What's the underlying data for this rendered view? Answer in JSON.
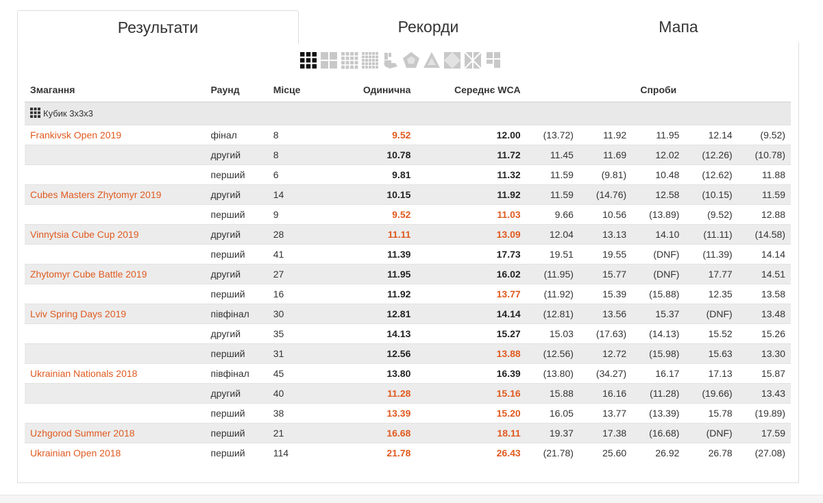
{
  "tabs": [
    {
      "label": "Результати",
      "active": true
    },
    {
      "label": "Рекорди",
      "active": false
    },
    {
      "label": "Мапа",
      "active": false
    }
  ],
  "events": [
    {
      "icon": "cube-3x3-icon",
      "selected": true
    },
    {
      "icon": "cube-2x2-icon",
      "selected": false
    },
    {
      "icon": "cube-4x4-icon",
      "selected": false
    },
    {
      "icon": "cube-5x5-icon",
      "selected": false
    },
    {
      "icon": "one-handed-icon",
      "selected": false
    },
    {
      "icon": "megaminx-icon",
      "selected": false
    },
    {
      "icon": "pyraminx-icon",
      "selected": false
    },
    {
      "icon": "skewb-icon",
      "selected": false
    },
    {
      "icon": "square-1-icon",
      "selected": false
    },
    {
      "icon": "clock-icon",
      "selected": false
    }
  ],
  "colors": {
    "accent": "#e05a1f",
    "stripe": "#ececec"
  },
  "table": {
    "headers": {
      "competition": "Змагання",
      "round": "Раунд",
      "place": "Місце",
      "single": "Одинична",
      "average": "Середнє WCA",
      "attempts": "Спроби"
    },
    "group_label": "Кубик 3x3x3",
    "rows": [
      {
        "competition": "Frankivsk Open 2019",
        "round": "фінал",
        "place": "8",
        "single": "9.52",
        "single_pr": true,
        "average": "12.00",
        "avg_pr": false,
        "attempts": [
          "(13.72)",
          "11.92",
          "11.95",
          "12.14",
          "(9.52)"
        ]
      },
      {
        "competition": "",
        "round": "другий",
        "place": "8",
        "single": "10.78",
        "single_pr": false,
        "average": "11.72",
        "avg_pr": false,
        "attempts": [
          "11.45",
          "11.69",
          "12.02",
          "(12.26)",
          "(10.78)"
        ]
      },
      {
        "competition": "",
        "round": "перший",
        "place": "6",
        "single": "9.81",
        "single_pr": false,
        "average": "11.32",
        "avg_pr": false,
        "attempts": [
          "11.59",
          "(9.81)",
          "10.48",
          "(12.62)",
          "11.88"
        ]
      },
      {
        "competition": "Cubes Masters Zhytomyr 2019",
        "round": "другий",
        "place": "14",
        "single": "10.15",
        "single_pr": false,
        "average": "11.92",
        "avg_pr": false,
        "attempts": [
          "11.59",
          "(14.76)",
          "12.58",
          "(10.15)",
          "11.59"
        ]
      },
      {
        "competition": "",
        "round": "перший",
        "place": "9",
        "single": "9.52",
        "single_pr": true,
        "average": "11.03",
        "avg_pr": true,
        "attempts": [
          "9.66",
          "10.56",
          "(13.89)",
          "(9.52)",
          "12.88"
        ]
      },
      {
        "competition": "Vinnytsia Cube Cup 2019",
        "round": "другий",
        "place": "28",
        "single": "11.11",
        "single_pr": true,
        "average": "13.09",
        "avg_pr": true,
        "attempts": [
          "12.04",
          "13.13",
          "14.10",
          "(11.11)",
          "(14.58)"
        ]
      },
      {
        "competition": "",
        "round": "перший",
        "place": "41",
        "single": "11.39",
        "single_pr": false,
        "average": "17.73",
        "avg_pr": false,
        "attempts": [
          "19.51",
          "19.55",
          "(DNF)",
          "(11.39)",
          "14.14"
        ]
      },
      {
        "competition": "Zhytomyr Cube Battle 2019",
        "round": "другий",
        "place": "27",
        "single": "11.95",
        "single_pr": false,
        "average": "16.02",
        "avg_pr": false,
        "attempts": [
          "(11.95)",
          "15.77",
          "(DNF)",
          "17.77",
          "14.51"
        ]
      },
      {
        "competition": "",
        "round": "перший",
        "place": "16",
        "single": "11.92",
        "single_pr": false,
        "average": "13.77",
        "avg_pr": true,
        "attempts": [
          "(11.92)",
          "15.39",
          "(15.88)",
          "12.35",
          "13.58"
        ]
      },
      {
        "competition": "Lviv Spring Days 2019",
        "round": "півфінал",
        "place": "30",
        "single": "12.81",
        "single_pr": false,
        "average": "14.14",
        "avg_pr": false,
        "attempts": [
          "(12.81)",
          "13.56",
          "15.37",
          "(DNF)",
          "13.48"
        ]
      },
      {
        "competition": "",
        "round": "другий",
        "place": "35",
        "single": "14.13",
        "single_pr": false,
        "average": "15.27",
        "avg_pr": false,
        "attempts": [
          "15.03",
          "(17.63)",
          "(14.13)",
          "15.52",
          "15.26"
        ]
      },
      {
        "competition": "",
        "round": "перший",
        "place": "31",
        "single": "12.56",
        "single_pr": false,
        "average": "13.88",
        "avg_pr": true,
        "attempts": [
          "(12.56)",
          "12.72",
          "(15.98)",
          "15.63",
          "13.30"
        ]
      },
      {
        "competition": "Ukrainian Nationals 2018",
        "round": "півфінал",
        "place": "45",
        "single": "13.80",
        "single_pr": false,
        "average": "16.39",
        "avg_pr": false,
        "attempts": [
          "(13.80)",
          "(34.27)",
          "16.17",
          "17.13",
          "15.87"
        ]
      },
      {
        "competition": "",
        "round": "другий",
        "place": "40",
        "single": "11.28",
        "single_pr": true,
        "average": "15.16",
        "avg_pr": true,
        "attempts": [
          "15.88",
          "16.16",
          "(11.28)",
          "(19.66)",
          "13.43"
        ]
      },
      {
        "competition": "",
        "round": "перший",
        "place": "38",
        "single": "13.39",
        "single_pr": true,
        "average": "15.20",
        "avg_pr": true,
        "attempts": [
          "16.05",
          "13.77",
          "(13.39)",
          "15.78",
          "(19.89)"
        ]
      },
      {
        "competition": "Uzhgorod Summer 2018",
        "round": "перший",
        "place": "21",
        "single": "16.68",
        "single_pr": true,
        "average": "18.11",
        "avg_pr": true,
        "attempts": [
          "19.37",
          "17.38",
          "(16.68)",
          "(DNF)",
          "17.59"
        ]
      },
      {
        "competition": "Ukrainian Open 2018",
        "round": "перший",
        "place": "114",
        "single": "21.78",
        "single_pr": true,
        "average": "26.43",
        "avg_pr": true,
        "attempts": [
          "(21.78)",
          "25.60",
          "26.92",
          "26.78",
          "(27.08)"
        ]
      }
    ]
  }
}
